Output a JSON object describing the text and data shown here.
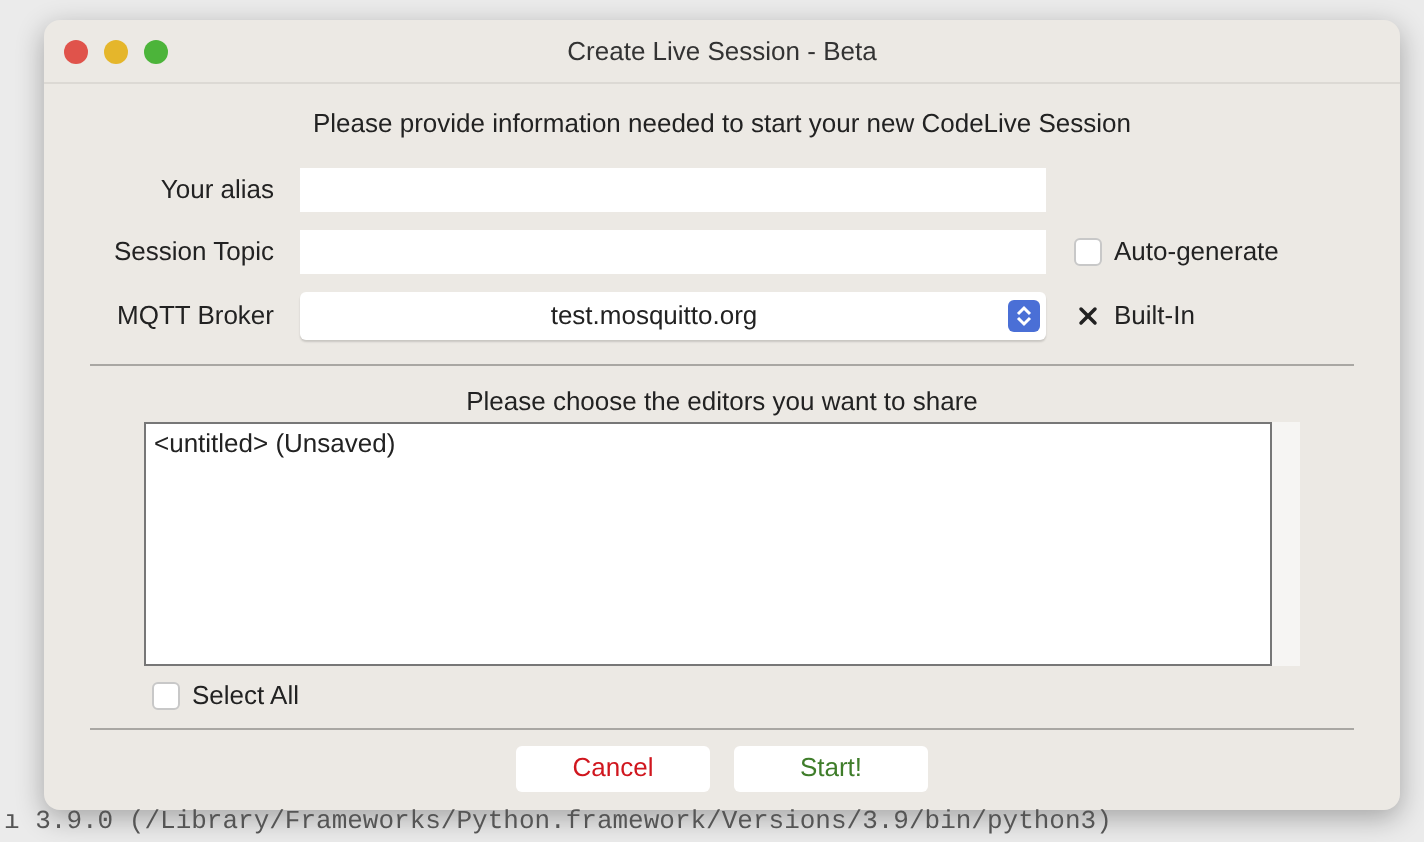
{
  "window": {
    "title": "Create Live Session - Beta"
  },
  "intro": "Please provide information needed to start your new CodeLive Session",
  "fields": [
    {
      "kind": "text",
      "label": "Your alias"
    },
    {
      "kind": "text",
      "label": "Session Topic",
      "option": {
        "label": "Auto-generate",
        "checked": false
      }
    },
    {
      "kind": "select",
      "label": "MQTT Broker",
      "value": "test.mosquitto.org",
      "option": {
        "label": "Built-In",
        "checked": true
      }
    }
  ],
  "editors": {
    "heading": "Please choose the editors you want to share",
    "items": [
      {
        "label": "<untitled> (Unsaved)",
        "selected": false
      }
    ],
    "select_all": {
      "label": "Select All",
      "checked": false
    }
  },
  "buttons": [
    {
      "label": "Cancel",
      "kind": "cancel"
    },
    {
      "label": "Start!",
      "kind": "start"
    }
  ],
  "console_line": "ı 3.9.0 (/Library/Frameworks/Python.framework/Versions/3.9/bin/python3)"
}
